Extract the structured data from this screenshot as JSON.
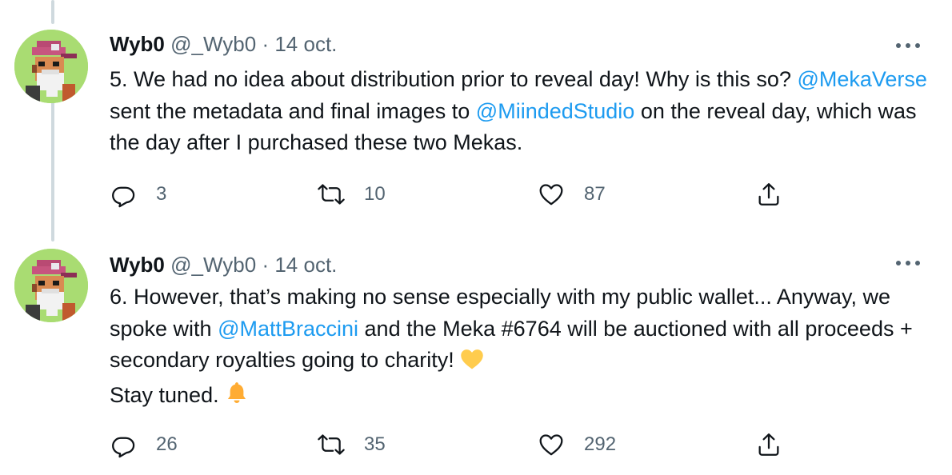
{
  "tweets": [
    {
      "name": "Wyb0",
      "handle": "@_Wyb0",
      "separator": "·",
      "date": "14 oct.",
      "text_parts": {
        "p1": "5. We had no idea about distribution prior to reveal day! Why is this so? ",
        "m1": "@MekaVerse",
        "p2": " sent the metadata and final images to ",
        "m2": "@MiindedStudio",
        "p3": " on the reveal day, which was the day after I purchased these two Mekas."
      },
      "replies": "3",
      "retweets": "10",
      "likes": "87"
    },
    {
      "name": "Wyb0",
      "handle": "@_Wyb0",
      "separator": "·",
      "date": "14 oct.",
      "text_parts": {
        "p1": "6. However, that’s making no sense especially with my public wallet... Anyway, we spoke with ",
        "m1": "@MattBraccini",
        "p2": " and the Meka #6764 will be auctioned with all proceeds + secondary royalties going to charity! ",
        "p3": "Stay tuned. "
      },
      "replies": "26",
      "retweets": "35",
      "likes": "292"
    }
  ],
  "icons": {
    "reply": "reply-icon",
    "retweet": "retweet-icon",
    "like": "heart-icon",
    "share": "share-icon",
    "more": "more-icon",
    "heart_emoji": "yellow-heart-emoji",
    "bell_emoji": "bell-emoji"
  },
  "colors": {
    "mention": "#1d9bf0",
    "secondary_text": "#536471",
    "avatar_bg": "#a9dc72",
    "thread_line": "#cfd9de"
  }
}
